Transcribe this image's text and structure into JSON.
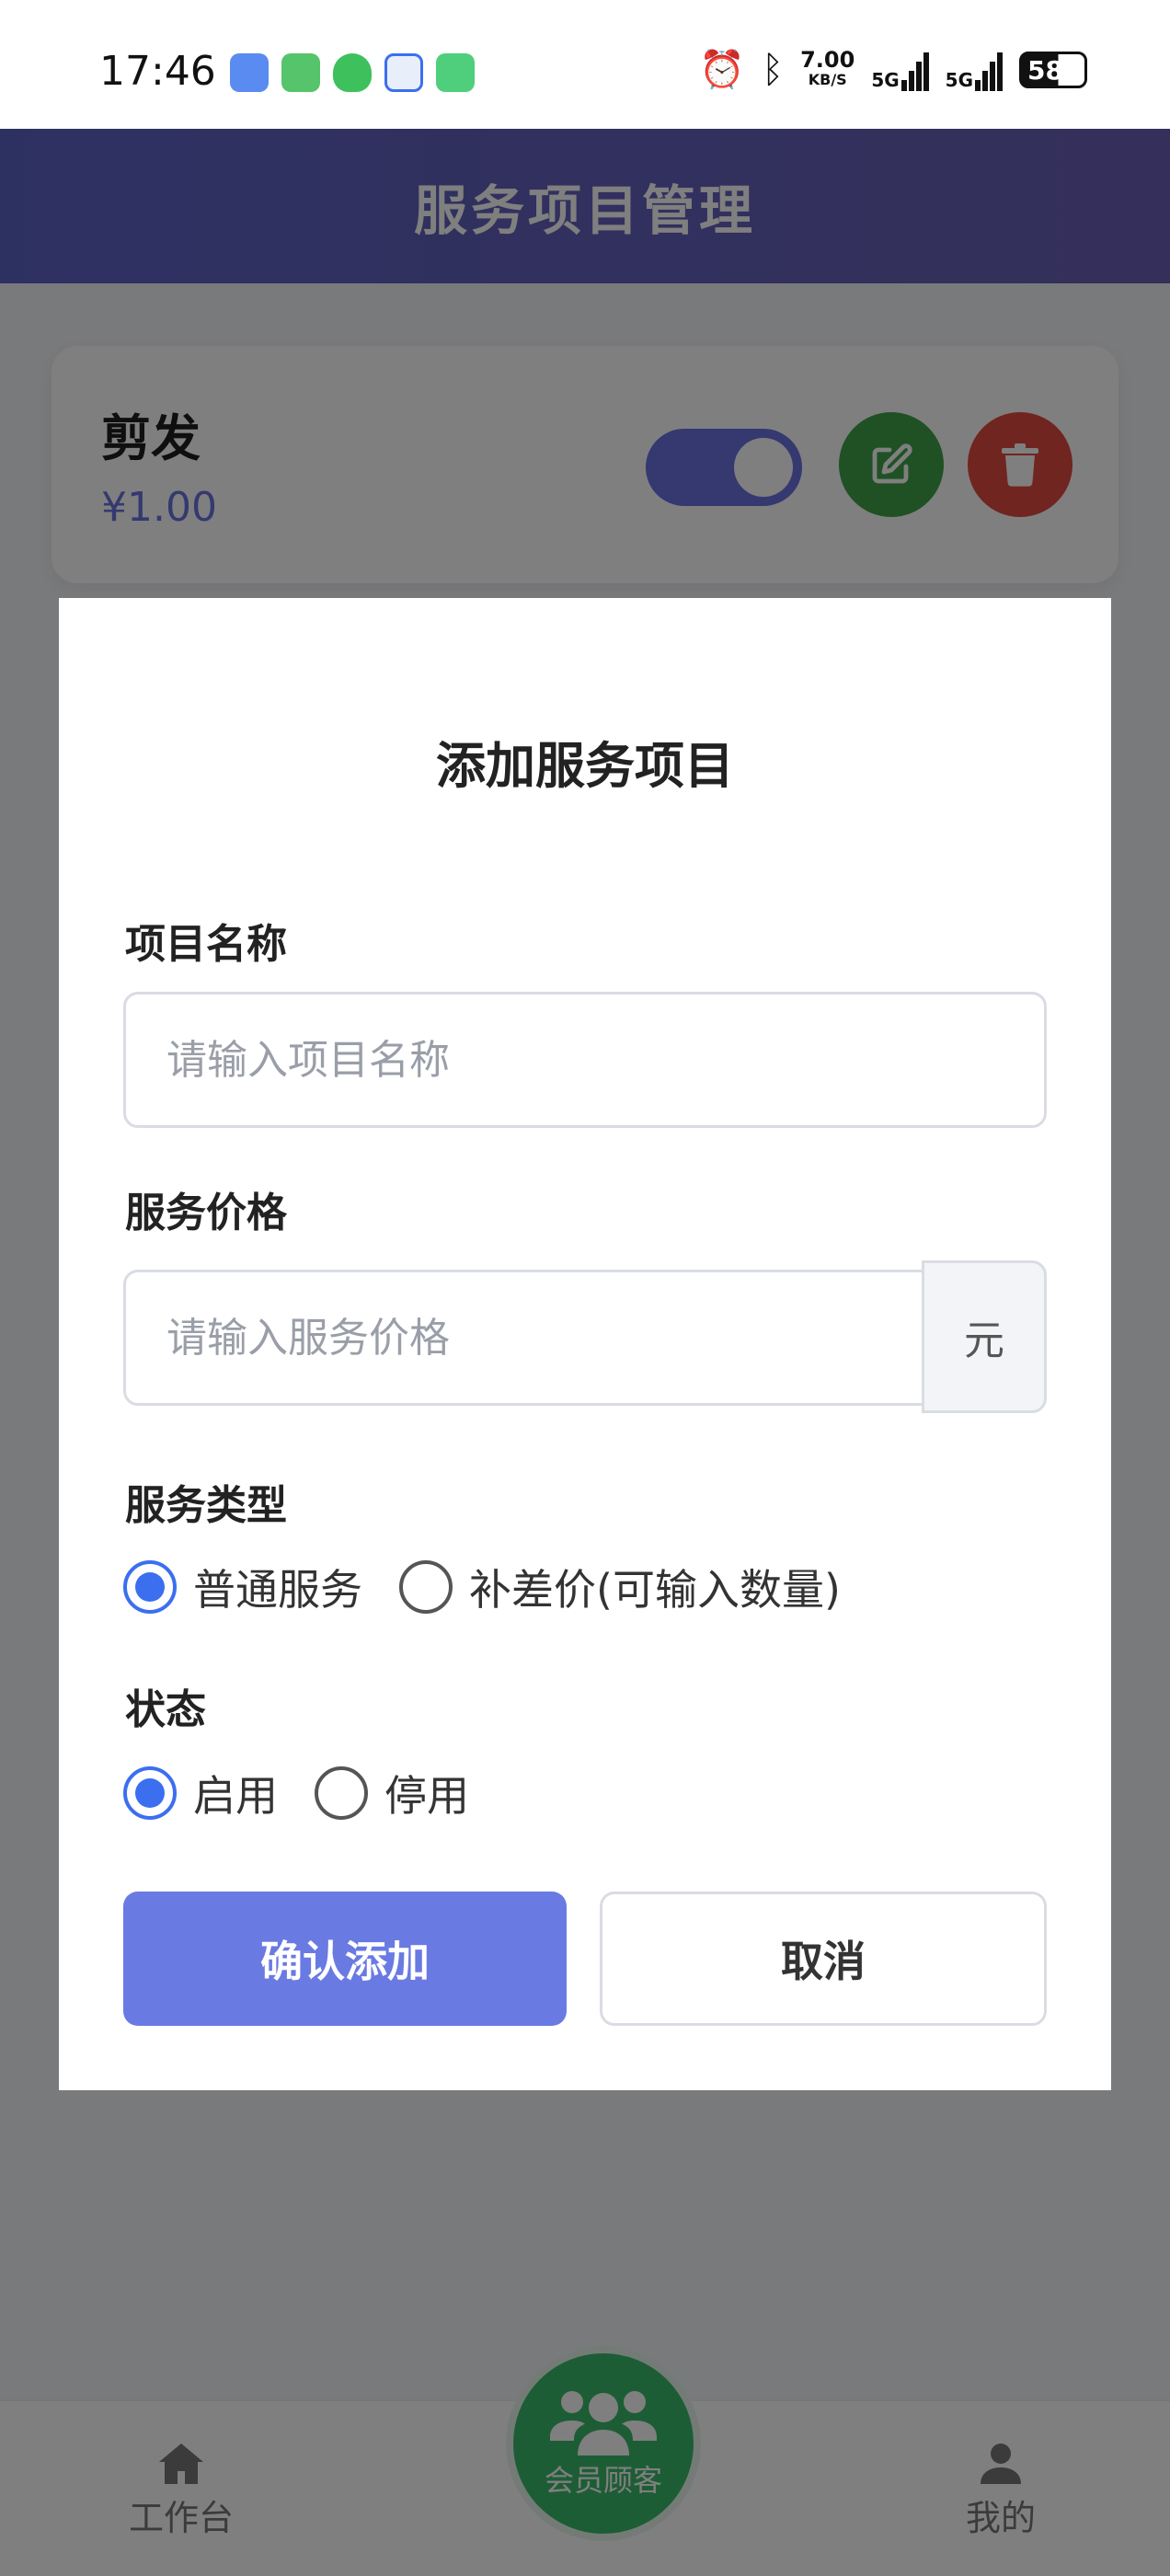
{
  "status_bar": {
    "time": "17:46",
    "net_speed_value": "7.00",
    "net_speed_unit": "KB/S",
    "network_1": "5G",
    "network_2": "5G",
    "battery": "58"
  },
  "header": {
    "title": "服务项目管理"
  },
  "service_list": [
    {
      "name": "剪发",
      "price": "¥1.00",
      "enabled": true
    }
  ],
  "modal": {
    "title": "添加服务项目",
    "name_label": "项目名称",
    "name_placeholder": "请输入项目名称",
    "name_value": "",
    "price_label": "服务价格",
    "price_placeholder": "请输入服务价格",
    "price_value": "",
    "price_unit": "元",
    "type_label": "服务类型",
    "type_options": [
      {
        "label": "普通服务",
        "selected": true
      },
      {
        "label": "补差价(可输入数量)",
        "selected": false
      }
    ],
    "status_label": "状态",
    "status_options": [
      {
        "label": "启用",
        "selected": true
      },
      {
        "label": "停用",
        "selected": false
      }
    ],
    "confirm_label": "确认添加",
    "cancel_label": "取消"
  },
  "bottom_nav": {
    "left_label": "工作台",
    "center_label": "会员顾客",
    "right_label": "我的"
  },
  "colors": {
    "primary": "#6a72e0",
    "edit": "#3fa24a",
    "delete": "#e14b40",
    "radio_selected": "#3b6ff0",
    "center_nav": "#3bbb6a"
  },
  "icons": {
    "edit": "edit-icon",
    "delete": "trash-icon",
    "add": "plus-icon",
    "home": "home-icon",
    "members": "users-icon",
    "profile": "user-icon"
  }
}
